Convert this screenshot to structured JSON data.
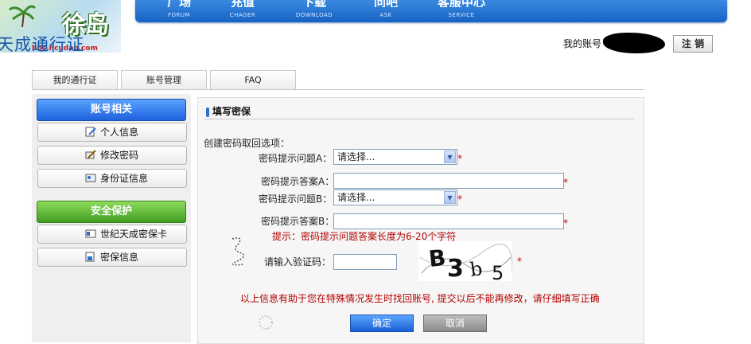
{
  "nav": {
    "items": [
      {
        "label": "广场",
        "sub": "FORUM"
      },
      {
        "label": "充值",
        "sub": "CHAGER"
      },
      {
        "label": "下载",
        "sub": "DOWNLOAD"
      },
      {
        "label": "问吧",
        "sub": "ASK"
      },
      {
        "label": "客服中心",
        "sub": "SERVICE"
      }
    ]
  },
  "logo": {
    "mark": "徐岛",
    "url": "bbs.hcudao.com",
    "brand": "天成通行证"
  },
  "account": {
    "label": "我的账号",
    "logout": "注 销"
  },
  "tabs": [
    {
      "label": "我的通行证"
    },
    {
      "label": "账号管理"
    },
    {
      "label": "FAQ"
    }
  ],
  "sidebar": {
    "group1": {
      "title": "账号相关",
      "items": [
        "个人信息",
        "修改密码",
        "身份证信息"
      ]
    },
    "group2": {
      "title": "安全保护",
      "items": [
        "世纪天成密保卡",
        "密保信息"
      ]
    }
  },
  "form": {
    "section_title": "填写密保",
    "intro": "创建密码取回选项：",
    "question_a_label": "密码提示问题A：",
    "question_a_value": "请选择...",
    "answer_a_label": "密码提示答案A：",
    "question_b_label": "密码提示问题B：",
    "question_b_value": "请选择...",
    "answer_b_label": "密码提示答案B：",
    "hint": "提示：密码提示问题答案长度为6-20个字符",
    "captcha_label": "请输入验证码：",
    "captcha_text": "B3b5",
    "required_mark": "*",
    "notice": "以上信息有助于您在特殊情况发生时找回账号, 提交以后不能再修改，请仔细填写正确",
    "confirm": "确定",
    "cancel": "取消"
  },
  "colors": {
    "nav_blue": "#1662c4",
    "accent_red": "#cc0000",
    "green": "#3f9e21"
  }
}
